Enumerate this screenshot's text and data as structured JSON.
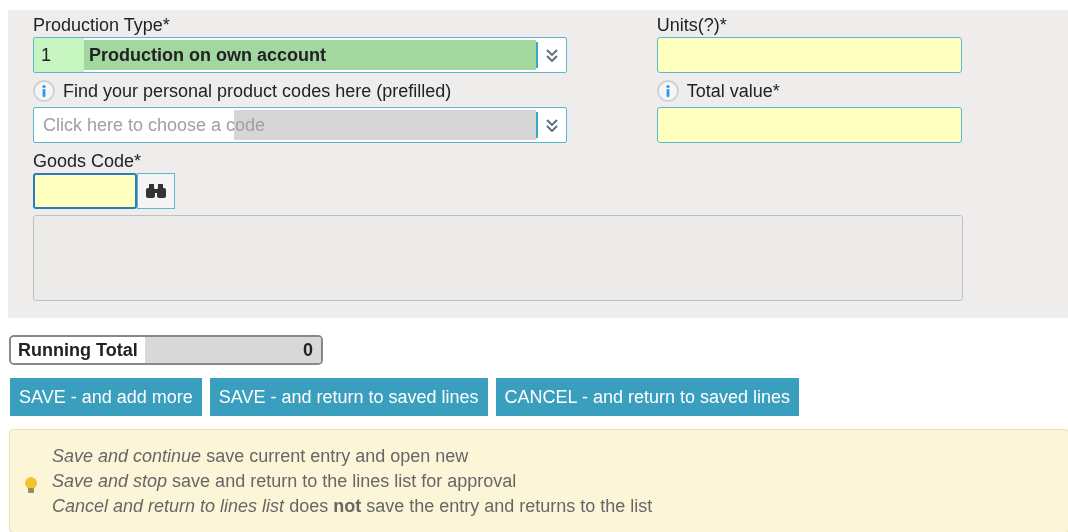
{
  "form": {
    "production_type": {
      "label": "Production Type*",
      "code": "1",
      "value": "Production on own account"
    },
    "product_codes": {
      "label": "Find your personal product codes here (prefilled)",
      "placeholder": "Click here to choose a code"
    },
    "goods_code": {
      "label": "Goods Code*",
      "focused": true
    },
    "units": {
      "label": "Units(?)*"
    },
    "total_value": {
      "label": "Total value*"
    }
  },
  "running_total": {
    "label": "Running Total",
    "value": "0"
  },
  "buttons": [
    "SAVE - and add more",
    "SAVE - and return to saved lines",
    "CANCEL - and return to saved lines"
  ],
  "tips": [
    "*Save and continue* save current entry and open new",
    "*Save and stop* save and return to the lines list for approval",
    "*Cancel and return to lines list* does **not** save the entry and returns to the list"
  ]
}
